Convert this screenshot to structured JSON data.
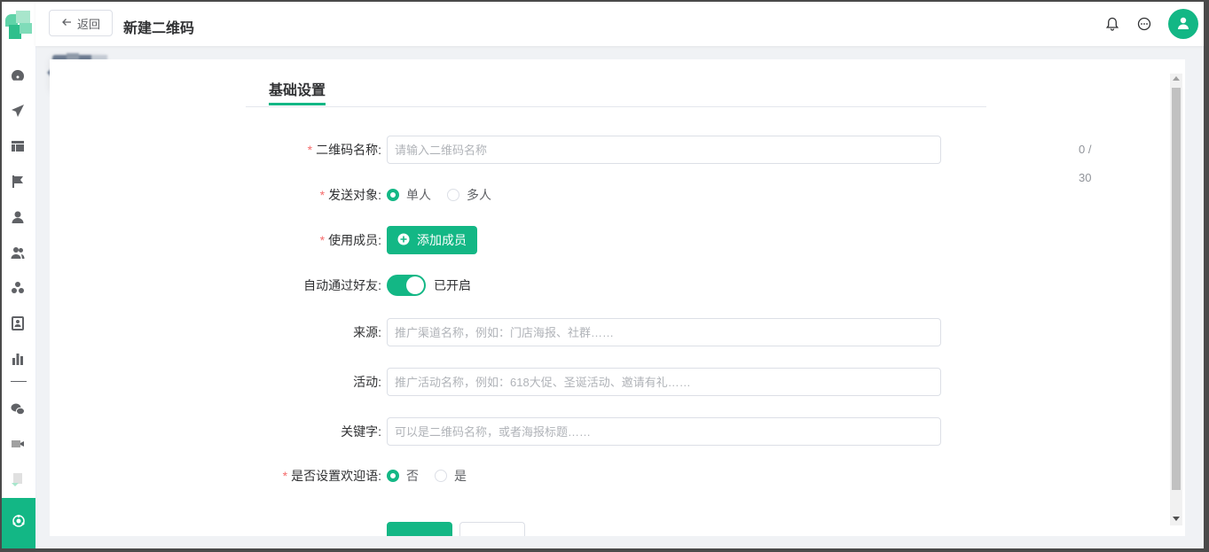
{
  "header": {
    "back_label": "返回",
    "title": "新建二维码"
  },
  "icons": {
    "sidebar": [
      "dashboard-icon",
      "send-icon",
      "layout-icon",
      "flag-icon",
      "user-icon",
      "users-icon",
      "group-icon",
      "contact-card-icon",
      "bar-chart-icon",
      "wechat-icon",
      "video-icon",
      "document-icon",
      "settings-active-icon"
    ],
    "header": [
      "bell-icon",
      "chat-icon",
      "avatar-user-icon"
    ]
  },
  "tabs": [
    {
      "label": "基础设置",
      "active": true
    }
  ],
  "form": {
    "qr_name": {
      "label": "二维码名称:",
      "required": true,
      "placeholder": "请输入二维码名称",
      "counter": "0 / 30"
    },
    "send_target": {
      "label": "发送对象:",
      "required": true,
      "options": [
        "单人",
        "多人"
      ],
      "selected": "单人"
    },
    "members": {
      "label": "使用成员:",
      "required": true,
      "button": "添加成员"
    },
    "auto_accept": {
      "label": "自动通过好友:",
      "status": "已开启",
      "on": true
    },
    "source": {
      "label": "来源:",
      "placeholder": "推广渠道名称，例如：门店海报、社群……"
    },
    "activity": {
      "label": "活动:",
      "placeholder": "推广活动名称，例如：618大促、圣诞活动、邀请有礼……"
    },
    "keyword": {
      "label": "关键字:",
      "placeholder": "可以是二维码名称，或者海报标题……"
    },
    "welcome": {
      "label": "是否设置欢迎语:",
      "required": true,
      "options": [
        "否",
        "是"
      ],
      "selected": "否"
    }
  },
  "colors": {
    "primary": "#13b785",
    "required": "#f56c6c",
    "text": "#303133"
  }
}
